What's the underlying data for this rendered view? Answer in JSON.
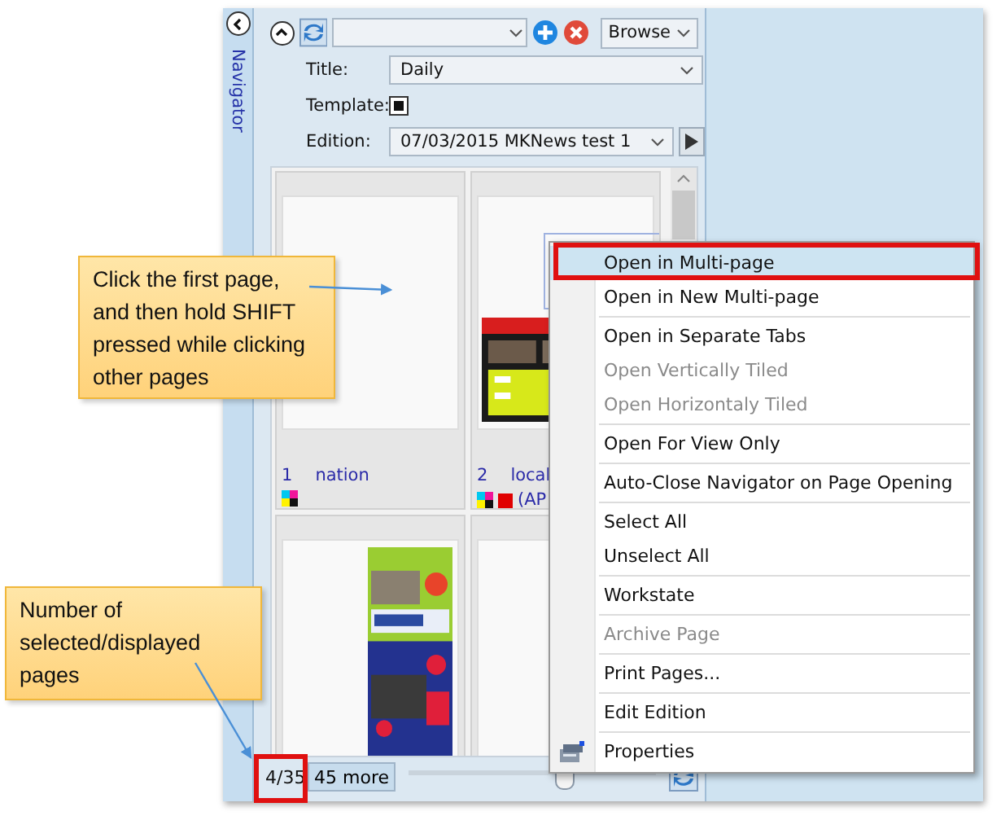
{
  "navigator_tab": {
    "label": "Navigator"
  },
  "toolbar": {
    "browse": "Browse"
  },
  "fields": [
    {
      "kind": "dropdown",
      "label": "Title:",
      "value": "Daily"
    },
    {
      "kind": "checkbox",
      "label": "Template:",
      "checked": true
    },
    {
      "kind": "dropdown",
      "label": "Edition:",
      "value": "07/03/2015 MKNews test 1"
    }
  ],
  "pages": [
    {
      "kind": "blank",
      "number": "1",
      "name": "nation",
      "flagged": false
    },
    {
      "kind": "ad",
      "number": "2",
      "name": "local",
      "status": "(AP",
      "flagged": true
    },
    {
      "kind": "flyer"
    },
    {
      "kind": "blank"
    }
  ],
  "footer": {
    "count": "4/35",
    "more": "45 more",
    "zoom": {
      "level": 0.63
    }
  },
  "context_menu": [
    [
      {
        "label": "Open in Multi-page",
        "selected": true,
        "disabled": false
      },
      {
        "label": "Open in New Multi-page",
        "selected": false,
        "disabled": false
      }
    ],
    [
      {
        "label": "Open in Separate Tabs",
        "selected": false,
        "disabled": false
      },
      {
        "label": "Open Vertically Tiled",
        "selected": false,
        "disabled": true
      },
      {
        "label": "Open Horizontaly Tiled",
        "selected": false,
        "disabled": true
      }
    ],
    [
      {
        "label": "Open For View Only",
        "selected": false,
        "disabled": false
      }
    ],
    [
      {
        "label": "Auto-Close Navigator on Page Opening",
        "selected": false,
        "disabled": false
      }
    ],
    [
      {
        "label": "Select All",
        "selected": false,
        "disabled": false
      },
      {
        "label": "Unselect All",
        "selected": false,
        "disabled": false
      }
    ],
    [
      {
        "label": "Workstate",
        "selected": false,
        "disabled": false
      }
    ],
    [
      {
        "label": "Archive Page",
        "selected": false,
        "disabled": true
      }
    ],
    [
      {
        "label": "Print Pages...",
        "selected": false,
        "disabled": false
      }
    ],
    [
      {
        "label": "Edit Edition",
        "selected": false,
        "disabled": false
      }
    ],
    [
      {
        "label": "Properties",
        "selected": false,
        "disabled": false,
        "kind": "icon"
      }
    ]
  ],
  "callouts": [
    {
      "text": "Click the first page, and then hold SHIFT pressed while clicking other pages"
    },
    {
      "text": "Number of selected/displayed pages"
    }
  ]
}
